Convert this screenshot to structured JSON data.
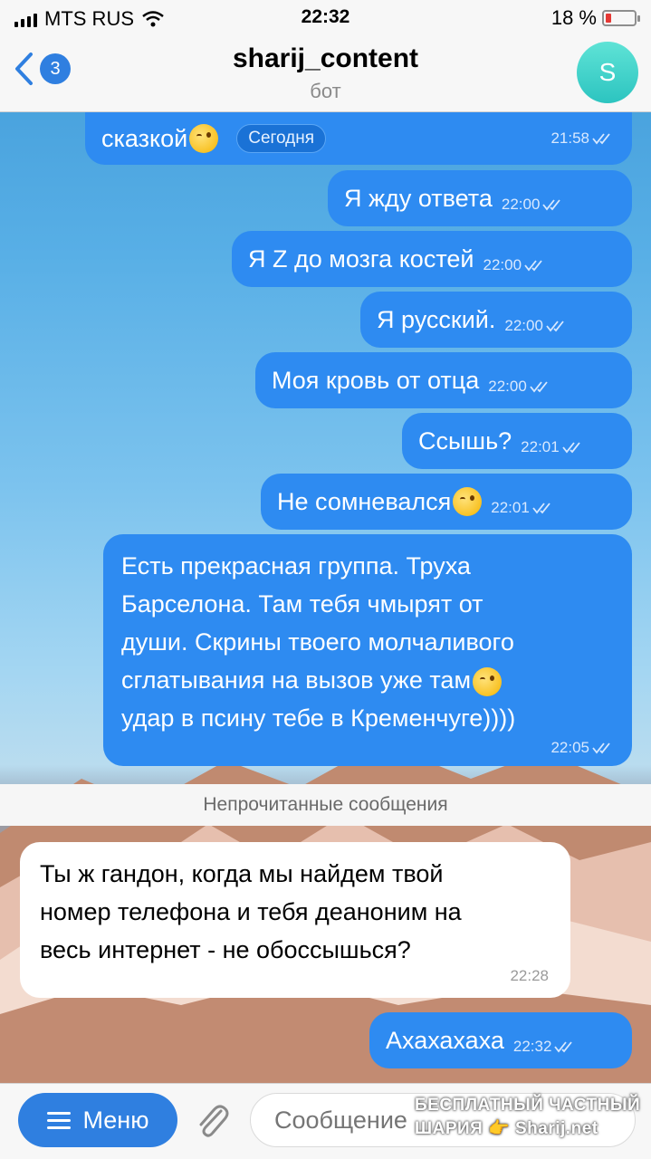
{
  "status_bar": {
    "carrier": "MTS RUS",
    "time": "22:32",
    "battery_percent": "18 %",
    "battery_level": 0.18
  },
  "header": {
    "back_badge": "3",
    "title": "sharij_content",
    "subtitle": "бот",
    "avatar_letter": "S"
  },
  "messages": [
    {
      "text": "сказкой",
      "time": "21:58",
      "emoji": "wink",
      "badge": "Сегодня"
    },
    {
      "text": "Я жду ответа",
      "time": "22:00"
    },
    {
      "text": "Я Z до мозга костей",
      "time": "22:00"
    },
    {
      "text": "Я русский.",
      "time": "22:00"
    },
    {
      "text": "Моя кровь от отца",
      "time": "22:00"
    },
    {
      "text": "Ссышь?",
      "time": "22:01"
    },
    {
      "text": "Не сомневался",
      "time": "22:01",
      "emoji": "wink"
    },
    {
      "lines": [
        "Есть прекрасная группа. Труха",
        "Барселона. Там тебя чмырят от",
        "души. Скрины твоего молчаливого",
        "сглатывания на вызов уже там",
        "удар в псину тебе в Кременчуге))))"
      ],
      "time": "22:05",
      "emoji": "wink"
    }
  ],
  "unread_divider": "Непрочитанные сообщения",
  "incoming": {
    "lines": [
      "Ты ж гандон, когда мы найдем твой",
      "номер телефона и тебя деаноним на",
      "весь интернет - не обоссышься?"
    ],
    "time": "22:28"
  },
  "last_message": {
    "text": "Ахахахаха",
    "time": "22:32"
  },
  "bottom_bar": {
    "menu_label": "Меню",
    "input_placeholder": "Сообщение",
    "watermark_line1": "БЕСПЛАТНЫЙ ЧАСТНЫЙ",
    "watermark_line2": "ШАРИЯ 👉 Sharij.net"
  },
  "colors": {
    "outgoing_bubble": "#2e8bf1",
    "incoming_bubble": "#ffffff",
    "accent": "#2f7fe0",
    "avatar": "#2cc4c0"
  }
}
